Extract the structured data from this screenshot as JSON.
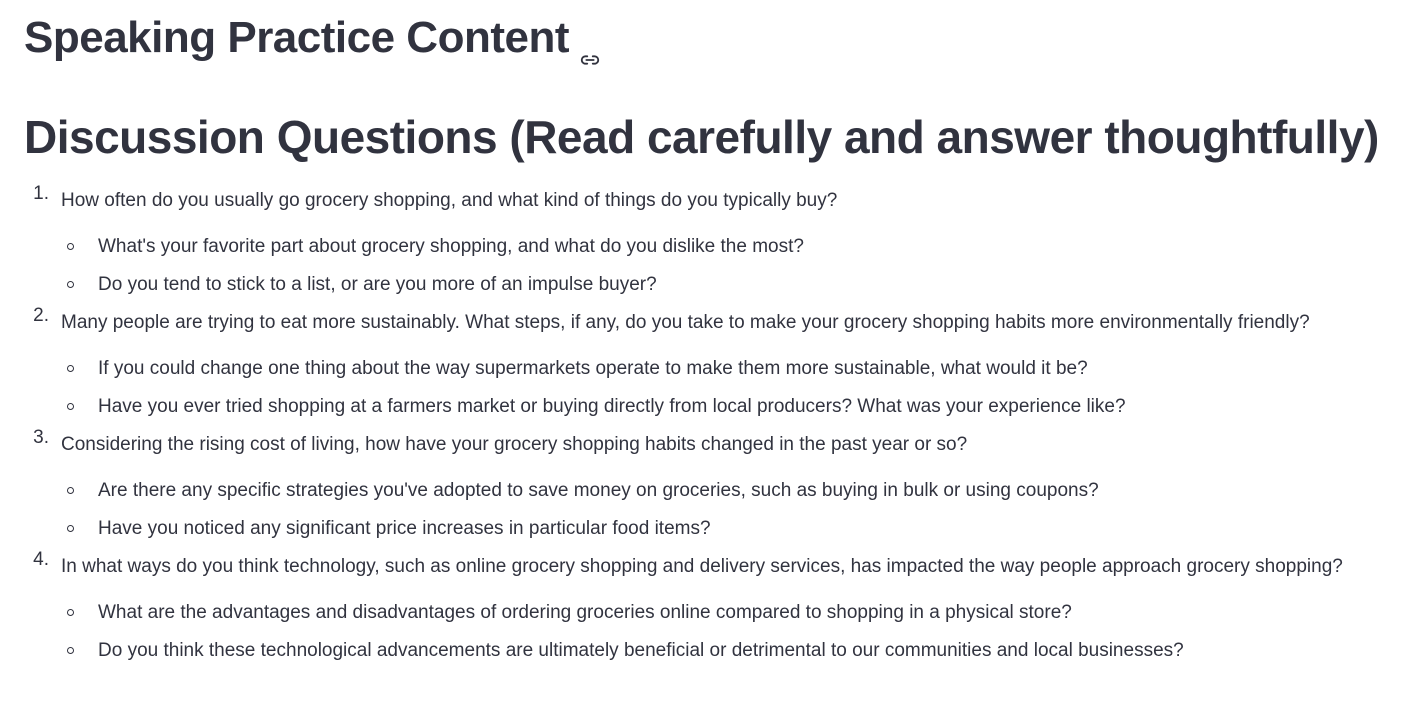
{
  "header": {
    "title": "Speaking Practice Content",
    "link_icon": "link-icon"
  },
  "section": {
    "title": "Discussion Questions (Read carefully and answer thoughtfully)"
  },
  "questions": [
    {
      "number": "1.",
      "text": "How often do you usually go grocery shopping, and what kind of things do you typically buy?",
      "subs": [
        "What's your favorite part about grocery shopping, and what do you dislike the most?",
        "Do you tend to stick to a list, or are you more of an impulse buyer?"
      ]
    },
    {
      "number": "2.",
      "text": "Many people are trying to eat more sustainably. What steps, if any, do you take to make your grocery shopping habits more environmentally friendly?",
      "subs": [
        "If you could change one thing about the way supermarkets operate to make them more sustainable, what would it be?",
        "Have you ever tried shopping at a farmers market or buying directly from local producers? What was your experience like?"
      ]
    },
    {
      "number": "3.",
      "text": "Considering the rising cost of living, how have your grocery shopping habits changed in the past year or so?",
      "subs": [
        "Are there any specific strategies you've adopted to save money on groceries, such as buying in bulk or using coupons?",
        "Have you noticed any significant price increases in particular food items?"
      ]
    },
    {
      "number": "4.",
      "text": "In what ways do you think technology, such as online grocery shopping and delivery services, has impacted the way people approach grocery shopping?",
      "subs": [
        "What are the advantages and disadvantages of ordering groceries online compared to shopping in a physical store?",
        "Do you think these technological advancements are ultimately beneficial or detrimental to our communities and local businesses?"
      ]
    }
  ]
}
